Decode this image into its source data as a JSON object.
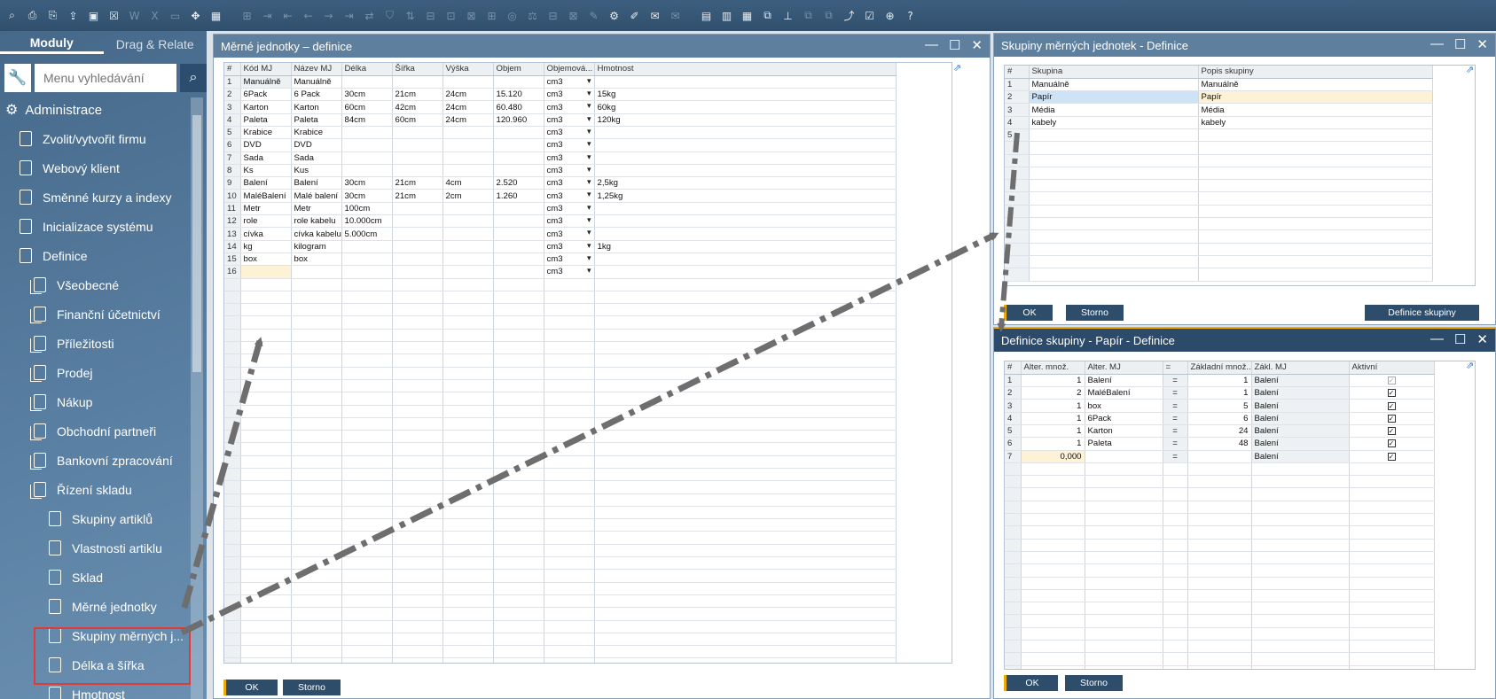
{
  "toolbar": {
    "icons": [
      "search-doc",
      "print",
      "print-preview",
      "export",
      "window",
      "close-doc",
      "word",
      "excel",
      "pdf",
      "move",
      "layout",
      "find",
      "forward",
      "first",
      "prev",
      "next",
      "last",
      "refresh",
      "filter",
      "sort",
      "split1",
      "split2",
      "split3",
      "split4",
      "split5",
      "scale",
      "split6",
      "split7",
      "edit",
      "settings",
      "edit2",
      "message",
      "message2",
      "report",
      "report2",
      "calc",
      "copy",
      "stamp",
      "copy2",
      "copy3",
      "chart",
      "checklist",
      "browser",
      "help"
    ]
  },
  "sidebar": {
    "tabs": [
      "Moduly",
      "Drag & Relate"
    ],
    "search_placeholder": "Menu vyhledávání",
    "admin_label": "Administrace",
    "items": [
      {
        "label": "Zvolit/vytvořit firmu",
        "level": 1
      },
      {
        "label": "Webový klient",
        "level": 1
      },
      {
        "label": "Směnné kurzy a indexy",
        "level": 1
      },
      {
        "label": "Inicializace systému",
        "level": 1
      },
      {
        "label": "Definice",
        "level": 1
      },
      {
        "label": "Všeobecné",
        "level": 2
      },
      {
        "label": "Finanční účetnictví",
        "level": 2
      },
      {
        "label": "Příležitosti",
        "level": 2
      },
      {
        "label": "Prodej",
        "level": 2
      },
      {
        "label": "Nákup",
        "level": 2
      },
      {
        "label": "Obchodní partneři",
        "level": 2
      },
      {
        "label": "Bankovní zpracování",
        "level": 2
      },
      {
        "label": "Řízení skladu",
        "level": 2
      },
      {
        "label": "Skupiny artiklů",
        "level": 3
      },
      {
        "label": "Vlastnosti artiklu",
        "level": 3
      },
      {
        "label": "Sklad",
        "level": 3
      },
      {
        "label": "Měrné jednotky",
        "level": 3
      },
      {
        "label": "Skupiny měrných j...",
        "level": 3
      },
      {
        "label": "Délka a šířka",
        "level": 3
      },
      {
        "label": "Hmotnost",
        "level": 3
      }
    ]
  },
  "win_uom": {
    "title": "Měrné jednotky – definice",
    "headers": [
      "#",
      "Kód MJ",
      "Název MJ",
      "Délka",
      "Šířka",
      "Výška",
      "Objem",
      "Objemová...",
      "Hmotnost"
    ],
    "rows": [
      [
        "1",
        "Manuálně",
        "Manuálně",
        "",
        "",
        "",
        "",
        "cm3",
        ""
      ],
      [
        "2",
        "6Pack",
        "6 Pack",
        "30cm",
        "21cm",
        "24cm",
        "15.120",
        "cm3",
        "15kg"
      ],
      [
        "3",
        "Karton",
        "Karton",
        "60cm",
        "42cm",
        "24cm",
        "60.480",
        "cm3",
        "60kg"
      ],
      [
        "4",
        "Paleta",
        "Paleta",
        "84cm",
        "60cm",
        "24cm",
        "120.960",
        "cm3",
        "120kg"
      ],
      [
        "5",
        "Krabice",
        "Krabice",
        "",
        "",
        "",
        "",
        "cm3",
        ""
      ],
      [
        "6",
        "DVD",
        "DVD",
        "",
        "",
        "",
        "",
        "cm3",
        ""
      ],
      [
        "7",
        "Sada",
        "Sada",
        "",
        "",
        "",
        "",
        "cm3",
        ""
      ],
      [
        "8",
        "Ks",
        "Kus",
        "",
        "",
        "",
        "",
        "cm3",
        ""
      ],
      [
        "9",
        "Balení",
        "Balení",
        "30cm",
        "21cm",
        "4cm",
        "2.520",
        "cm3",
        "2,5kg"
      ],
      [
        "10",
        "MaléBalení",
        "Malé balení",
        "30cm",
        "21cm",
        "2cm",
        "1.260",
        "cm3",
        "1,25kg"
      ],
      [
        "11",
        "Metr",
        "Metr",
        "100cm",
        "",
        "",
        "",
        "cm3",
        ""
      ],
      [
        "12",
        "role",
        "role kabelu",
        "10.000cm",
        "",
        "",
        "",
        "cm3",
        ""
      ],
      [
        "13",
        "cívka",
        "cívka kabelu",
        "5.000cm",
        "",
        "",
        "",
        "cm3",
        ""
      ],
      [
        "14",
        "kg",
        "kilogram",
        "",
        "",
        "",
        "",
        "cm3",
        "1kg"
      ],
      [
        "15",
        "box",
        "box",
        "",
        "",
        "",
        "",
        "cm3",
        ""
      ],
      [
        "16",
        "",
        "",
        "",
        "",
        "",
        "",
        "cm3",
        ""
      ]
    ],
    "ok": "OK",
    "cancel": "Storno"
  },
  "win_groups": {
    "title": "Skupiny měrných jednotek - Definice",
    "headers": [
      "#",
      "Skupina",
      "Popis skupiny"
    ],
    "rows": [
      [
        "1",
        "Manuálně",
        "Manuálně"
      ],
      [
        "2",
        "Papír",
        "Papír"
      ],
      [
        "3",
        "Média",
        "Média"
      ],
      [
        "4",
        "kabely",
        "kabely"
      ],
      [
        "5",
        "",
        ""
      ]
    ],
    "ok": "OK",
    "cancel": "Storno",
    "define": "Definice skupiny"
  },
  "win_def": {
    "title": "Definice skupiny - Papír - Definice",
    "headers": [
      "#",
      "Alter. množ.",
      "Alter. MJ",
      "=",
      "Základní množ...",
      "Zákl. MJ",
      "Aktivní"
    ],
    "rows": [
      [
        "1",
        "1",
        "Balení",
        "=",
        "1",
        "Balení",
        "disabled"
      ],
      [
        "2",
        "2",
        "MaléBalení",
        "=",
        "1",
        "Balení",
        "checked"
      ],
      [
        "3",
        "1",
        "box",
        "=",
        "5",
        "Balení",
        "checked"
      ],
      [
        "4",
        "1",
        "6Pack",
        "=",
        "6",
        "Balení",
        "checked"
      ],
      [
        "5",
        "1",
        "Karton",
        "=",
        "24",
        "Balení",
        "checked"
      ],
      [
        "6",
        "1",
        "Paleta",
        "=",
        "48",
        "Balení",
        "checked"
      ],
      [
        "7",
        "0,000",
        "",
        "=",
        "",
        "Balení",
        "checked"
      ]
    ],
    "ok": "OK",
    "cancel": "Storno"
  },
  "colors": {
    "toolbar": "#2f4f6d",
    "sidebar": "#4a6d8f",
    "button": "#2e4d6b",
    "accent": "#f0ab00",
    "highlight": "#e03a3a"
  }
}
